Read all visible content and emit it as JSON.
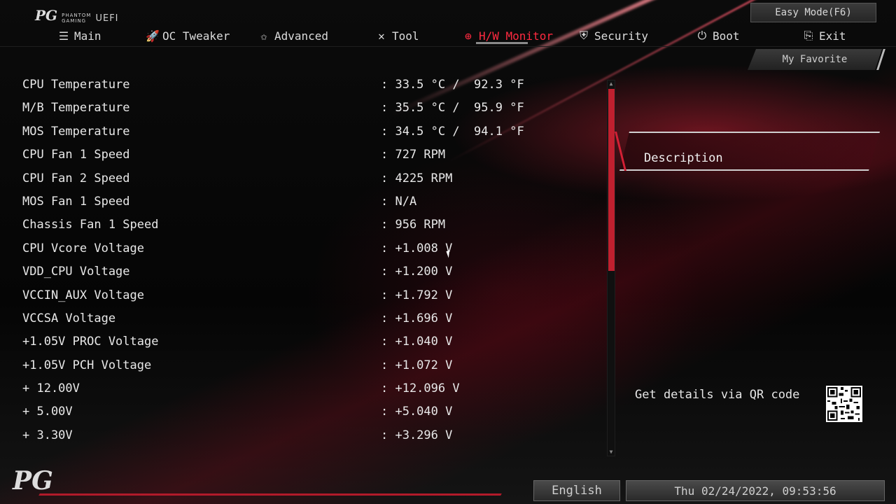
{
  "header": {
    "logo_small": [
      "PHANTOM",
      "GAMING"
    ],
    "logo_uefi": "UEFI",
    "easy_mode_label": "Easy Mode(F6)",
    "favorite_label": "My Favorite"
  },
  "nav": {
    "items": [
      {
        "label": "Main",
        "icon": "list-icon"
      },
      {
        "label": "OC Tweaker",
        "icon": "rocket-icon"
      },
      {
        "label": "Advanced",
        "icon": "star-icon"
      },
      {
        "label": "Tool",
        "icon": "tools-icon"
      },
      {
        "label": "H/W Monitor",
        "icon": "monitor-icon",
        "active": true
      },
      {
        "label": "Security",
        "icon": "shield-icon"
      },
      {
        "label": "Boot",
        "icon": "power-icon"
      },
      {
        "label": "Exit",
        "icon": "exit-icon"
      }
    ]
  },
  "monitor": {
    "rows": [
      {
        "label": "CPU Temperature",
        "value": ": 33.5 °C /  92.3 °F"
      },
      {
        "label": "M/B Temperature",
        "value": ": 35.5 °C /  95.9 °F"
      },
      {
        "label": "MOS Temperature",
        "value": ": 34.5 °C /  94.1 °F"
      },
      {
        "label": "CPU Fan 1 Speed",
        "value": ": 727 RPM"
      },
      {
        "label": "CPU Fan 2 Speed",
        "value": ": 4225 RPM"
      },
      {
        "label": "MOS Fan 1 Speed",
        "value": ": N/A"
      },
      {
        "label": "Chassis Fan 1 Speed",
        "value": ": 956 RPM"
      },
      {
        "label": "CPU Vcore Voltage",
        "value": ": +1.008 V"
      },
      {
        "label": "VDD_CPU Voltage",
        "value": ": +1.200 V"
      },
      {
        "label": "VCCIN_AUX Voltage",
        "value": ": +1.792 V"
      },
      {
        "label": "VCCSA Voltage",
        "value": ": +1.696 V"
      },
      {
        "label": "+1.05V PROC Voltage",
        "value": ": +1.040 V"
      },
      {
        "label": "+1.05V PCH Voltage",
        "value": ": +1.072 V"
      },
      {
        "label": "+ 12.00V",
        "value": ": +12.096 V"
      },
      {
        "label": "+ 5.00V",
        "value": ": +5.040 V"
      },
      {
        "label": "+ 3.30V",
        "value": ": +3.296 V"
      }
    ]
  },
  "sidebar": {
    "description_title": "Description",
    "qr_text": "Get details via QR code"
  },
  "footer": {
    "language": "English",
    "datetime": "Thu 02/24/2022, 09:53:56"
  },
  "colors": {
    "accent": "#d42035",
    "active_tab": "#ff2a40"
  }
}
